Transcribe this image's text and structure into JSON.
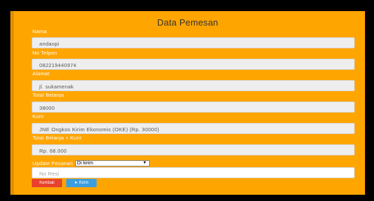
{
  "form": {
    "title": "Data Pemesan",
    "fields": [
      {
        "label": "Nama",
        "value": "andaopi"
      },
      {
        "label": "No Telpon",
        "value": "082219440974"
      },
      {
        "label": "Alamat",
        "value": "jl. sukamenak"
      },
      {
        "label": "Total Belanja",
        "value": "38000"
      },
      {
        "label": "Kurir",
        "value": "JNE Ongkos Kirim Ekonomis (OKE) (Rp. 30000)"
      },
      {
        "label": "Total Belanja + Kurir",
        "value": "Rp. 68.000"
      }
    ],
    "update_label": "Update Pesanan",
    "status_selected": "Di kirim",
    "resi_placeholder": "No Resi",
    "back_button": "Kembali",
    "send_button": "Kirim"
  },
  "colors": {
    "panel": "#ffa500",
    "back_button": "#e8412c",
    "send_button": "#3a9ee0"
  },
  "icons": {
    "send": "paper-plane-icon",
    "select": "caret-down-icon"
  }
}
